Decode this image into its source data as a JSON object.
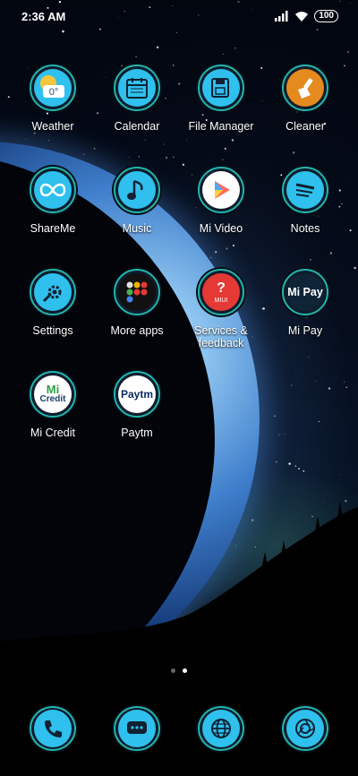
{
  "status_bar": {
    "time": "2:36 AM",
    "battery": "100"
  },
  "apps": [
    {
      "id": "weather",
      "label": "Weather",
      "icon": "weather-icon",
      "temp": "0°",
      "color": "#2fc0ee"
    },
    {
      "id": "calendar",
      "label": "Calendar",
      "icon": "calendar-icon",
      "color": "#2fc0ee"
    },
    {
      "id": "file-manager",
      "label": "File Manager",
      "icon": "file-manager-icon",
      "color": "#2fc0ee"
    },
    {
      "id": "cleaner",
      "label": "Cleaner",
      "icon": "cleaner-icon",
      "color": "#e48a1e"
    },
    {
      "id": "shareme",
      "label": "ShareMe",
      "icon": "shareme-icon",
      "color": "#2fc0ee"
    },
    {
      "id": "music",
      "label": "Music",
      "icon": "music-note-icon",
      "color": "#2fc0ee"
    },
    {
      "id": "mi-video",
      "label": "Mi Video",
      "icon": "play-icon",
      "color": "#ffffff"
    },
    {
      "id": "notes",
      "label": "Notes",
      "icon": "notes-icon",
      "color": "#2fc0ee"
    },
    {
      "id": "settings",
      "label": "Settings",
      "icon": "settings-icon",
      "color": "#2fc0ee"
    },
    {
      "id": "more-apps",
      "label": "More apps",
      "icon": "folder-icon",
      "color": "#111111"
    },
    {
      "id": "services",
      "label": "Services & feedback",
      "icon": "services-feedback-icon",
      "badge": "MIUI",
      "color": "#e53935"
    },
    {
      "id": "mi-pay",
      "label": "Mi Pay",
      "icon": "mi-pay-icon",
      "text": "Mi Pay",
      "color": "#2fc0ee"
    },
    {
      "id": "mi-credit",
      "label": "Mi Credit",
      "icon": "mi-credit-icon",
      "text": "Mi",
      "subtext": "Credit",
      "color": "#ffffff"
    },
    {
      "id": "paytm",
      "label": "Paytm",
      "icon": "paytm-icon",
      "text": "Paytm",
      "color": "#ffffff"
    }
  ],
  "dock": [
    {
      "id": "phone",
      "icon": "phone-icon"
    },
    {
      "id": "messages",
      "icon": "messages-icon"
    },
    {
      "id": "browser",
      "icon": "globe-icon"
    },
    {
      "id": "camera",
      "icon": "camera-icon"
    }
  ],
  "page_indicator": {
    "pages": 2,
    "current": 2
  }
}
